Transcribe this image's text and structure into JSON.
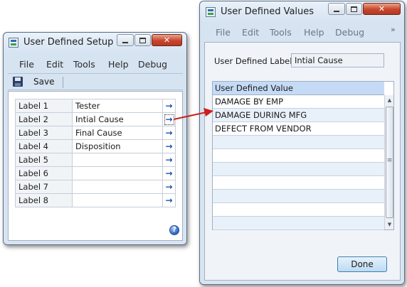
{
  "setup_window": {
    "title": "User Defined Setup",
    "menu": [
      "File",
      "Edit",
      "Tools",
      "Help",
      "Debug"
    ],
    "toolbar": {
      "save_label": "Save"
    },
    "rows": [
      {
        "label": "Label 1",
        "value": "Tester"
      },
      {
        "label": "Label 2",
        "value": "Intial Cause"
      },
      {
        "label": "Label 3",
        "value": "Final Cause"
      },
      {
        "label": "Label 4",
        "value": "Disposition"
      },
      {
        "label": "Label 5",
        "value": ""
      },
      {
        "label": "Label 6",
        "value": ""
      },
      {
        "label": "Label 7",
        "value": ""
      },
      {
        "label": "Label 8",
        "value": ""
      }
    ],
    "arrow_glyph": "→",
    "help_glyph": "?"
  },
  "values_window": {
    "title": "User Defined Values",
    "menu": [
      "File",
      "Edit",
      "Tools",
      "Help",
      "Debug"
    ],
    "overflow_glyph": "»",
    "field_label": "User Defined Label",
    "field_value": "Intial Cause",
    "list_header": "User Defined Value",
    "list_items": [
      "DAMAGE BY EMP",
      "DAMAGE DURING MFG",
      "DEFECT FROM VENDOR",
      "",
      "",
      "",
      "",
      "",
      "",
      ""
    ],
    "done_label": "Done"
  },
  "icons": {
    "close": "✕",
    "scroll_up": "▲",
    "scroll_down": "▼",
    "grip": "≡"
  },
  "colors": {
    "connector_arrow": "#cc1f1f",
    "link_arrow": "#1f4fb0",
    "list_header_bg": "#c5daf5",
    "list_alt_row": "#e8f0fa"
  }
}
